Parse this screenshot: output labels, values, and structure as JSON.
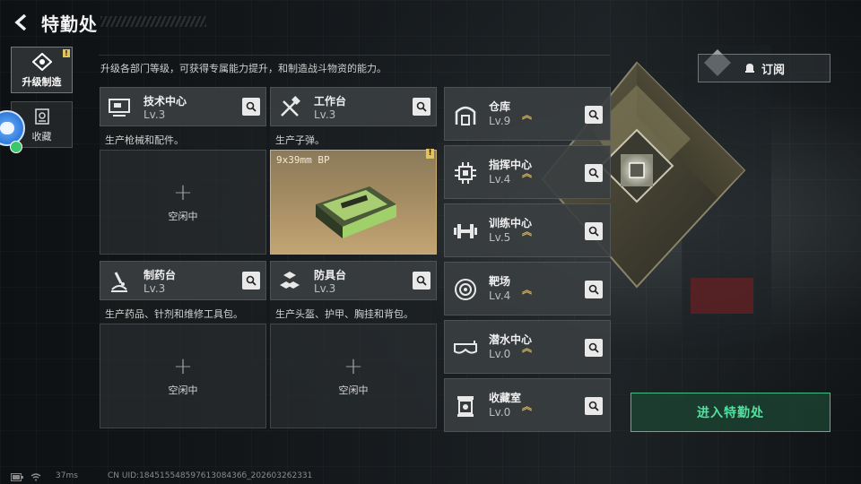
{
  "header": {
    "title": "特勤处"
  },
  "tabs": [
    {
      "label": "升级制造",
      "active": true,
      "alert": "!"
    },
    {
      "label": "收藏",
      "active": false
    }
  ],
  "description": "升级各部门等级，可获得专属能力提升，和制造战斗物资的能力。",
  "benches": [
    {
      "name": "技术中心",
      "level": "Lv.3",
      "subtitle": "生产枪械和配件。",
      "slot_plus": "+",
      "slot_status": "空闲中",
      "icon": "monitor-icon"
    },
    {
      "name": "工作台",
      "level": "Lv.3",
      "subtitle": "生产子弹。",
      "slot_item": "9x39mm BP",
      "alert": "!",
      "icon": "tools-icon"
    },
    {
      "name": "制药台",
      "level": "Lv.3",
      "subtitle": "生产药品、针剂和维修工具包。",
      "slot_plus": "+",
      "slot_status": "空闲中",
      "icon": "microscope-icon"
    },
    {
      "name": "防具台",
      "level": "Lv.3",
      "subtitle": "生产头盔、护甲、胸挂和背包。",
      "slot_plus": "+",
      "slot_status": "空闲中",
      "icon": "armor-boxes-icon"
    }
  ],
  "facilities": [
    {
      "name": "仓库",
      "level": "Lv.9",
      "icon": "warehouse-icon"
    },
    {
      "name": "指挥中心",
      "level": "Lv.4",
      "icon": "chip-icon"
    },
    {
      "name": "训练中心",
      "level": "Lv.5",
      "icon": "dumbbell-icon"
    },
    {
      "name": "靶场",
      "level": "Lv.4",
      "icon": "target-icon"
    },
    {
      "name": "潜水中心",
      "level": "Lv.0",
      "icon": "goggles-icon"
    },
    {
      "name": "收藏室",
      "level": "Lv.0",
      "icon": "trophy-icon"
    }
  ],
  "upgrade_arrow": "︽",
  "subscribe_label": "订阅",
  "enter_label": "进入特勤处",
  "footer": {
    "ping": "37ms",
    "uid": "CN UID:18451554859761308436б_202603262331"
  },
  "colors": {
    "accent_green": "#54e0a0",
    "level_up_gold": "#d8b562",
    "alert_yellow": "#e1c45a"
  }
}
